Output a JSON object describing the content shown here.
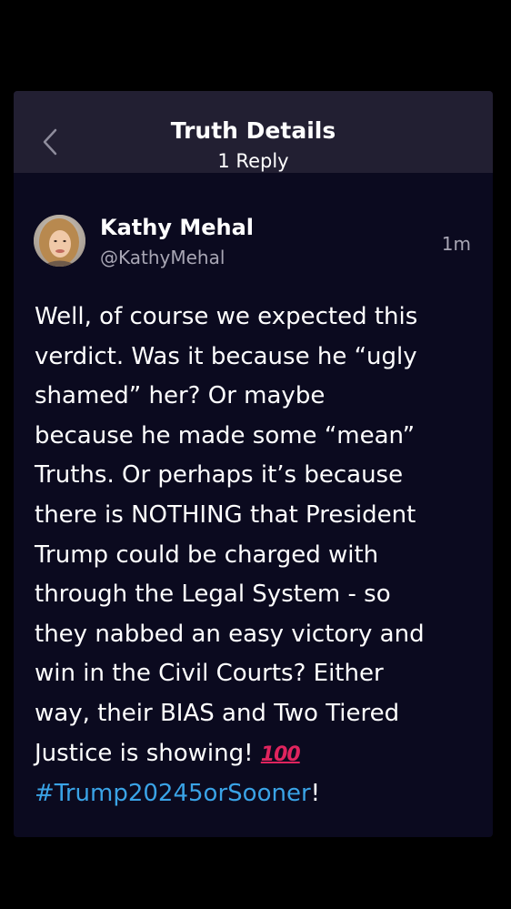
{
  "header": {
    "title": "Truth Details",
    "subtitle": "1 Reply",
    "back_icon": "chevron-left-icon"
  },
  "post": {
    "author": {
      "name": "Kathy Mehal",
      "handle": "@KathyMehal",
      "avatar": "avatar-photo"
    },
    "timestamp": "1m",
    "lines": [
      "Well, of course we expected this",
      "verdict. Was it because he “ugly",
      "shamed” her? Or maybe",
      "because he made some “mean”",
      "Truths. Or perhaps it’s because",
      "there is NOTHING that President",
      "Trump could be charged with",
      "through the Legal System - so",
      "they nabbed an easy victory and",
      "win in the Civil Courts? Either",
      "way, their BIAS and Two Tiered",
      "Justice is showing!"
    ],
    "emoji": "100",
    "hashtag": "#Trump20245orSooner",
    "trailing": "!"
  },
  "colors": {
    "page_background": "#000000",
    "card_background": "#0b0a1f",
    "header_background": "#221f32",
    "text_primary": "#ffffff",
    "text_secondary": "#a8a6b4",
    "hashtag": "#3aa3e6",
    "emoji_red": "#e0245e"
  }
}
